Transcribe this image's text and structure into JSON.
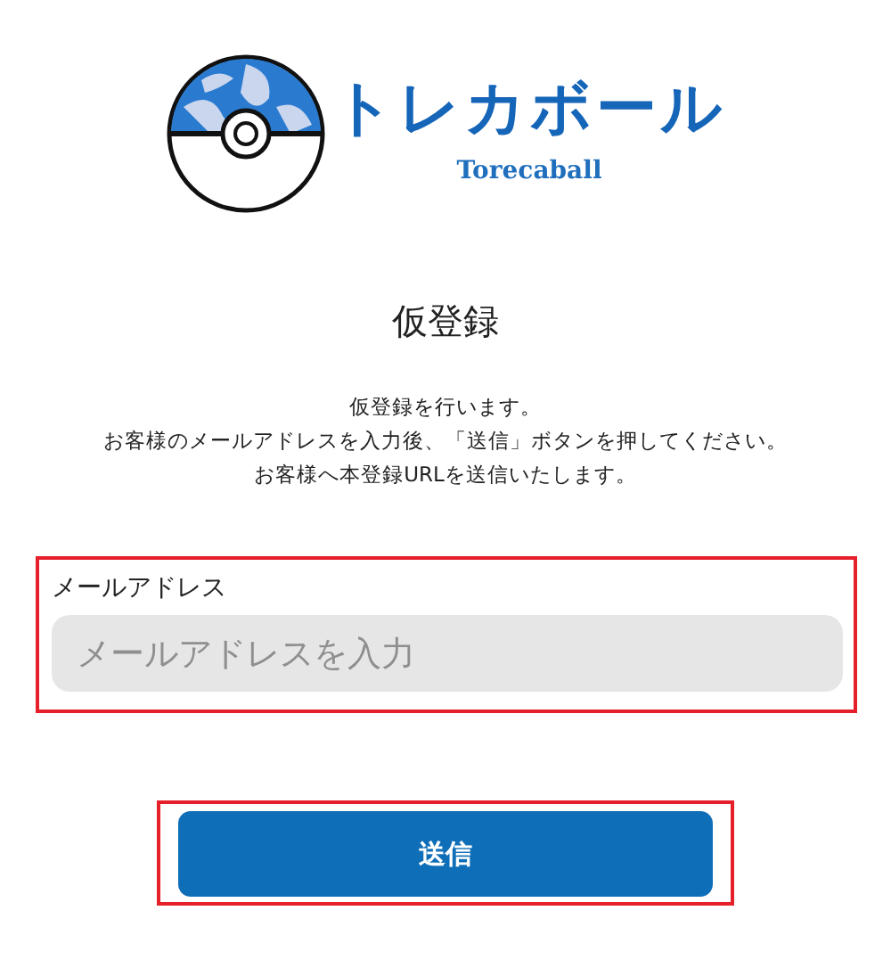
{
  "logo": {
    "title": "トレカボール",
    "subtitle": "Torecaball"
  },
  "heading": "仮登録",
  "description": [
    "仮登録を行います。",
    "お客様のメールアドレスを入力後、「送信」ボタンを押してください。",
    "お客様へ本登録URLを送信いたします。"
  ],
  "email_field": {
    "label": "メールアドレス",
    "placeholder": "メールアドレスを入力",
    "highlighted": true
  },
  "submit_button": {
    "label": "送信",
    "highlighted": true
  }
}
